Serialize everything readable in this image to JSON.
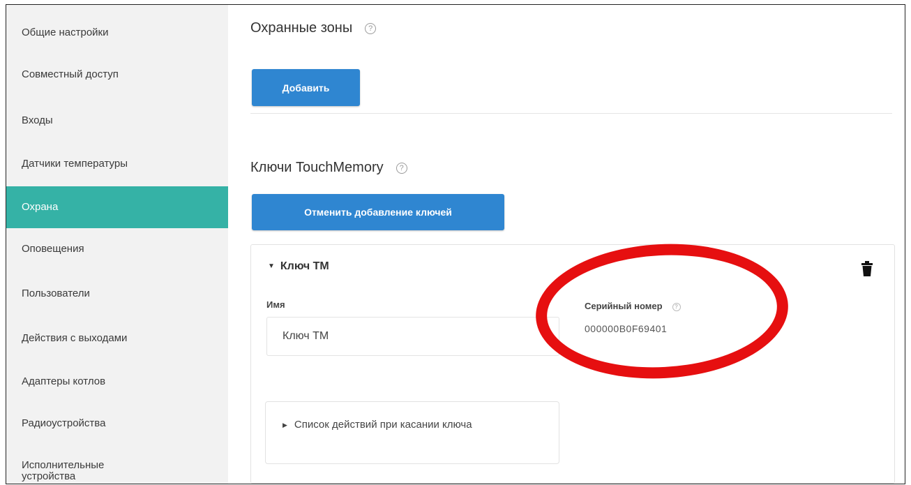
{
  "sidebar": {
    "items": [
      {
        "label": "Общие настройки"
      },
      {
        "label": "Совместный доступ"
      },
      {
        "label": "Входы"
      },
      {
        "label": "Датчики температуры"
      },
      {
        "label": "Охрана",
        "active": true
      },
      {
        "label": "Оповещения"
      },
      {
        "label": "Пользователи"
      },
      {
        "label": "Действия с выходами"
      },
      {
        "label": "Адаптеры котлов"
      },
      {
        "label": "Радиоустройства"
      },
      {
        "label": "Исполнительные устройства"
      }
    ]
  },
  "zones": {
    "title": "Охранные зоны",
    "help_icon": "?",
    "add_button": "Добавить"
  },
  "keys": {
    "title": "Ключи TouchMemory",
    "help_icon": "?",
    "cancel_button": "Отменить добавление ключей",
    "card": {
      "header": "Ключ ТМ",
      "caret": "▼",
      "name_label": "Имя",
      "name_value": "Ключ ТМ",
      "serial_label": "Серийный номер",
      "serial_help": "?",
      "serial_value": "000000B0F69401",
      "actions_caret": "▶",
      "actions_label": "Список действий при касании ключа"
    }
  },
  "colors": {
    "active": "#35b2a6",
    "button": "#2f86d1",
    "annotation": "#e60f10"
  }
}
